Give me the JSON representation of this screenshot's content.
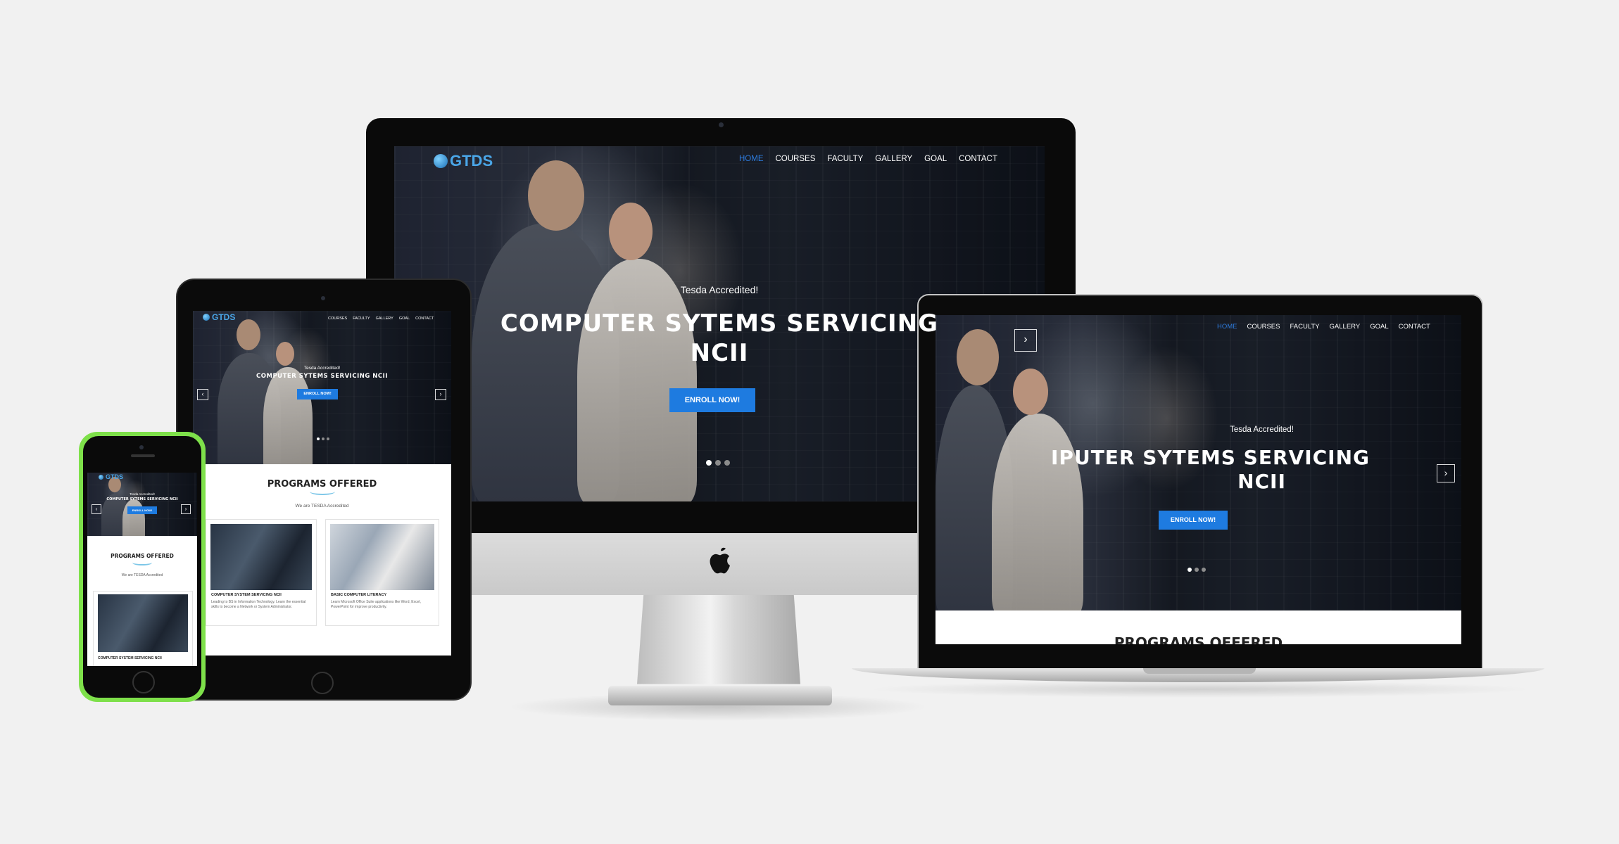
{
  "site": {
    "logo_text": "GTDS",
    "nav": [
      "HOME",
      "COURSES",
      "FACULTY",
      "GALLERY",
      "GOAL",
      "CONTACT"
    ],
    "hero": {
      "eyebrow": "Tesda Accredited!",
      "title_line1": "COMPUTER SYTEMS SERVICING",
      "title_line2": "NCII",
      "title_full": "COMPUTER SYTEMS SERVICING NCII",
      "cta": "ENROLL NOW!",
      "slides": 3,
      "active_slide": 1
    },
    "programs": {
      "title": "PROGRAMS OFFERED",
      "subtitle": "We are TESDA Accredited",
      "cards": [
        {
          "title": "COMPUTER SYSTEM SERVICING NCII",
          "description": "Leading to BS in Information Technology. Learn the essential skills to become a Network or System Administrator."
        },
        {
          "title": "BASIC COMPUTER LITERACY",
          "description": "Learn Microsoft Office Suite applications like Word, Excel, PowerPoint for improve productivity."
        }
      ]
    }
  },
  "laptop_partial": {
    "title_line1": "IPUTER SYTEMS SERVICING",
    "programs_title_partial": "PROGRAMS OFFERED"
  },
  "colors": {
    "accent": "#1e7be0",
    "phone_frame": "#7ee04a",
    "background": "#f1f1f1"
  },
  "icons": {
    "brand": "apple-logo-icon",
    "next": "chevron-right-icon",
    "prev": "chevron-left-icon"
  }
}
